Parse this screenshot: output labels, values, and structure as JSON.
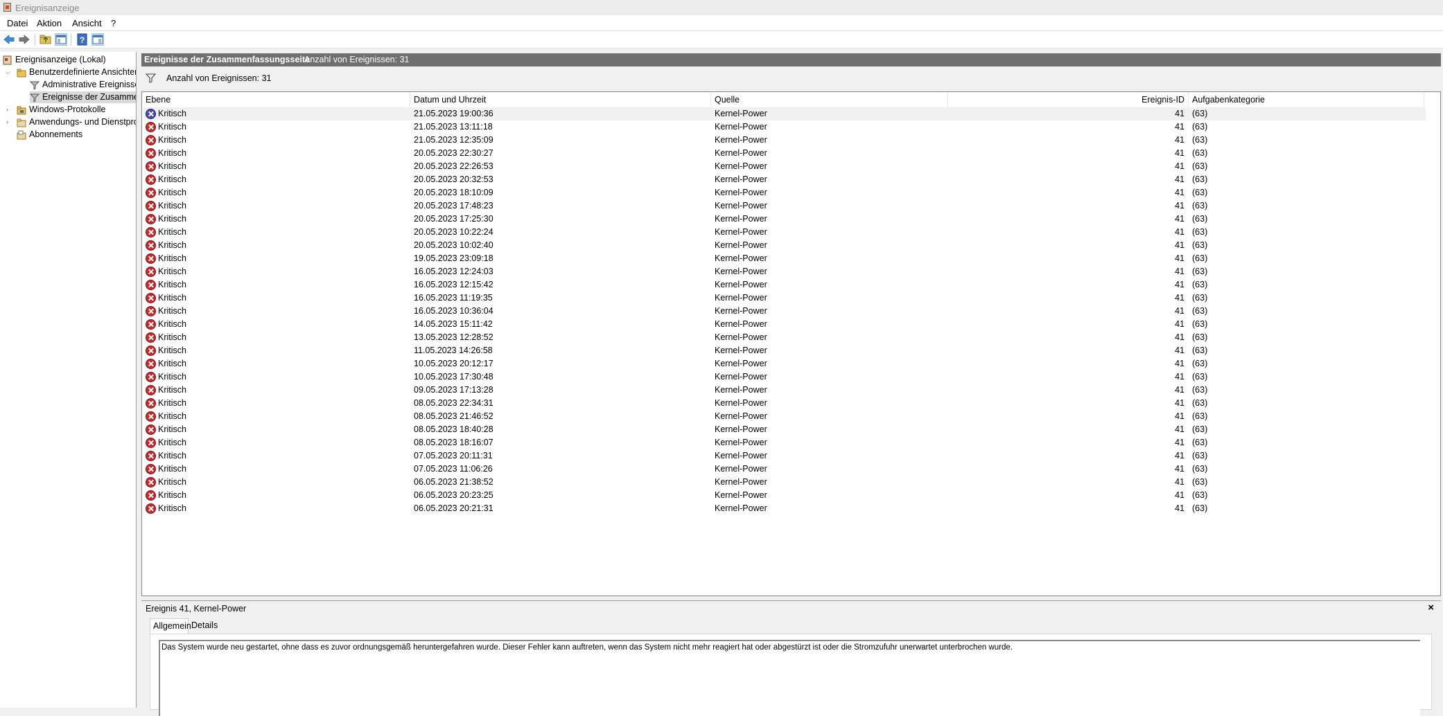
{
  "window": {
    "title": "Ereignisanzeige"
  },
  "menu": {
    "items": [
      "Datei",
      "Aktion",
      "Ansicht",
      "?"
    ]
  },
  "toolbar": {
    "buttons": [
      "back-icon",
      "forward-icon",
      "folder-up-icon",
      "show-hide-console-tree-icon",
      "help-icon",
      "show-hide-action-pane-icon"
    ]
  },
  "tree": {
    "root": "Ereignisanzeige (Lokal)",
    "custom_views": "Benutzerdefinierte Ansichten",
    "admin_events": "Administrative Ereignisse",
    "summary_events": "Ereignisse der Zusammenfassungsseite",
    "windows_logs": "Windows-Protokolle",
    "app_service_logs": "Anwendungs- und Dienstprotokolle",
    "subscriptions": "Abonnements"
  },
  "main": {
    "header_title": "Ereignisse der Zusammenfassungsseite",
    "header_count": "Anzahl von Ereignissen: 31",
    "filter_text": "Anzahl von Ereignissen: 31",
    "columns": {
      "level": "Ebene",
      "datetime": "Datum und Uhrzeit",
      "source": "Quelle",
      "event_id": "Ereignis-ID",
      "task_category": "Aufgabenkategorie"
    }
  },
  "events": [
    {
      "level": "Kritisch",
      "datetime": "21.05.2023 19:00:36",
      "source": "Kernel-Power",
      "id": "41",
      "category": "(63)"
    },
    {
      "level": "Kritisch",
      "datetime": "21.05.2023 13:11:18",
      "source": "Kernel-Power",
      "id": "41",
      "category": "(63)"
    },
    {
      "level": "Kritisch",
      "datetime": "21.05.2023 12:35:09",
      "source": "Kernel-Power",
      "id": "41",
      "category": "(63)"
    },
    {
      "level": "Kritisch",
      "datetime": "20.05.2023 22:30:27",
      "source": "Kernel-Power",
      "id": "41",
      "category": "(63)"
    },
    {
      "level": "Kritisch",
      "datetime": "20.05.2023 22:26:53",
      "source": "Kernel-Power",
      "id": "41",
      "category": "(63)"
    },
    {
      "level": "Kritisch",
      "datetime": "20.05.2023 20:32:53",
      "source": "Kernel-Power",
      "id": "41",
      "category": "(63)"
    },
    {
      "level": "Kritisch",
      "datetime": "20.05.2023 18:10:09",
      "source": "Kernel-Power",
      "id": "41",
      "category": "(63)"
    },
    {
      "level": "Kritisch",
      "datetime": "20.05.2023 17:48:23",
      "source": "Kernel-Power",
      "id": "41",
      "category": "(63)"
    },
    {
      "level": "Kritisch",
      "datetime": "20.05.2023 17:25:30",
      "source": "Kernel-Power",
      "id": "41",
      "category": "(63)"
    },
    {
      "level": "Kritisch",
      "datetime": "20.05.2023 10:22:24",
      "source": "Kernel-Power",
      "id": "41",
      "category": "(63)"
    },
    {
      "level": "Kritisch",
      "datetime": "20.05.2023 10:02:40",
      "source": "Kernel-Power",
      "id": "41",
      "category": "(63)"
    },
    {
      "level": "Kritisch",
      "datetime": "19.05.2023 23:09:18",
      "source": "Kernel-Power",
      "id": "41",
      "category": "(63)"
    },
    {
      "level": "Kritisch",
      "datetime": "16.05.2023 12:24:03",
      "source": "Kernel-Power",
      "id": "41",
      "category": "(63)"
    },
    {
      "level": "Kritisch",
      "datetime": "16.05.2023 12:15:42",
      "source": "Kernel-Power",
      "id": "41",
      "category": "(63)"
    },
    {
      "level": "Kritisch",
      "datetime": "16.05.2023 11:19:35",
      "source": "Kernel-Power",
      "id": "41",
      "category": "(63)"
    },
    {
      "level": "Kritisch",
      "datetime": "16.05.2023 10:36:04",
      "source": "Kernel-Power",
      "id": "41",
      "category": "(63)"
    },
    {
      "level": "Kritisch",
      "datetime": "14.05.2023 15:11:42",
      "source": "Kernel-Power",
      "id": "41",
      "category": "(63)"
    },
    {
      "level": "Kritisch",
      "datetime": "13.05.2023 12:28:52",
      "source": "Kernel-Power",
      "id": "41",
      "category": "(63)"
    },
    {
      "level": "Kritisch",
      "datetime": "11.05.2023 14:26:58",
      "source": "Kernel-Power",
      "id": "41",
      "category": "(63)"
    },
    {
      "level": "Kritisch",
      "datetime": "10.05.2023 20:12:17",
      "source": "Kernel-Power",
      "id": "41",
      "category": "(63)"
    },
    {
      "level": "Kritisch",
      "datetime": "10.05.2023 17:30:48",
      "source": "Kernel-Power",
      "id": "41",
      "category": "(63)"
    },
    {
      "level": "Kritisch",
      "datetime": "09.05.2023 17:13:28",
      "source": "Kernel-Power",
      "id": "41",
      "category": "(63)"
    },
    {
      "level": "Kritisch",
      "datetime": "08.05.2023 22:34:31",
      "source": "Kernel-Power",
      "id": "41",
      "category": "(63)"
    },
    {
      "level": "Kritisch",
      "datetime": "08.05.2023 21:46:52",
      "source": "Kernel-Power",
      "id": "41",
      "category": "(63)"
    },
    {
      "level": "Kritisch",
      "datetime": "08.05.2023 18:40:28",
      "source": "Kernel-Power",
      "id": "41",
      "category": "(63)"
    },
    {
      "level": "Kritisch",
      "datetime": "08.05.2023 18:16:07",
      "source": "Kernel-Power",
      "id": "41",
      "category": "(63)"
    },
    {
      "level": "Kritisch",
      "datetime": "07.05.2023 20:11:31",
      "source": "Kernel-Power",
      "id": "41",
      "category": "(63)"
    },
    {
      "level": "Kritisch",
      "datetime": "07.05.2023 11:06:26",
      "source": "Kernel-Power",
      "id": "41",
      "category": "(63)"
    },
    {
      "level": "Kritisch",
      "datetime": "06.05.2023 21:38:52",
      "source": "Kernel-Power",
      "id": "41",
      "category": "(63)"
    },
    {
      "level": "Kritisch",
      "datetime": "06.05.2023 20:23:25",
      "source": "Kernel-Power",
      "id": "41",
      "category": "(63)"
    },
    {
      "level": "Kritisch",
      "datetime": "06.05.2023 20:21:31",
      "source": "Kernel-Power",
      "id": "41",
      "category": "(63)"
    }
  ],
  "detail": {
    "title": "Ereignis 41, Kernel-Power",
    "close": "×",
    "tabs": [
      "Allgemein",
      "Details"
    ],
    "message": "Das System wurde neu gestartet, ohne dass es zuvor ordnungsgemäß heruntergefahren wurde. Dieser Fehler kann auftreten, wenn das System nicht mehr reagiert hat oder abgestürzt ist oder die Stromzufuhr unerwartet unterbrochen wurde."
  }
}
